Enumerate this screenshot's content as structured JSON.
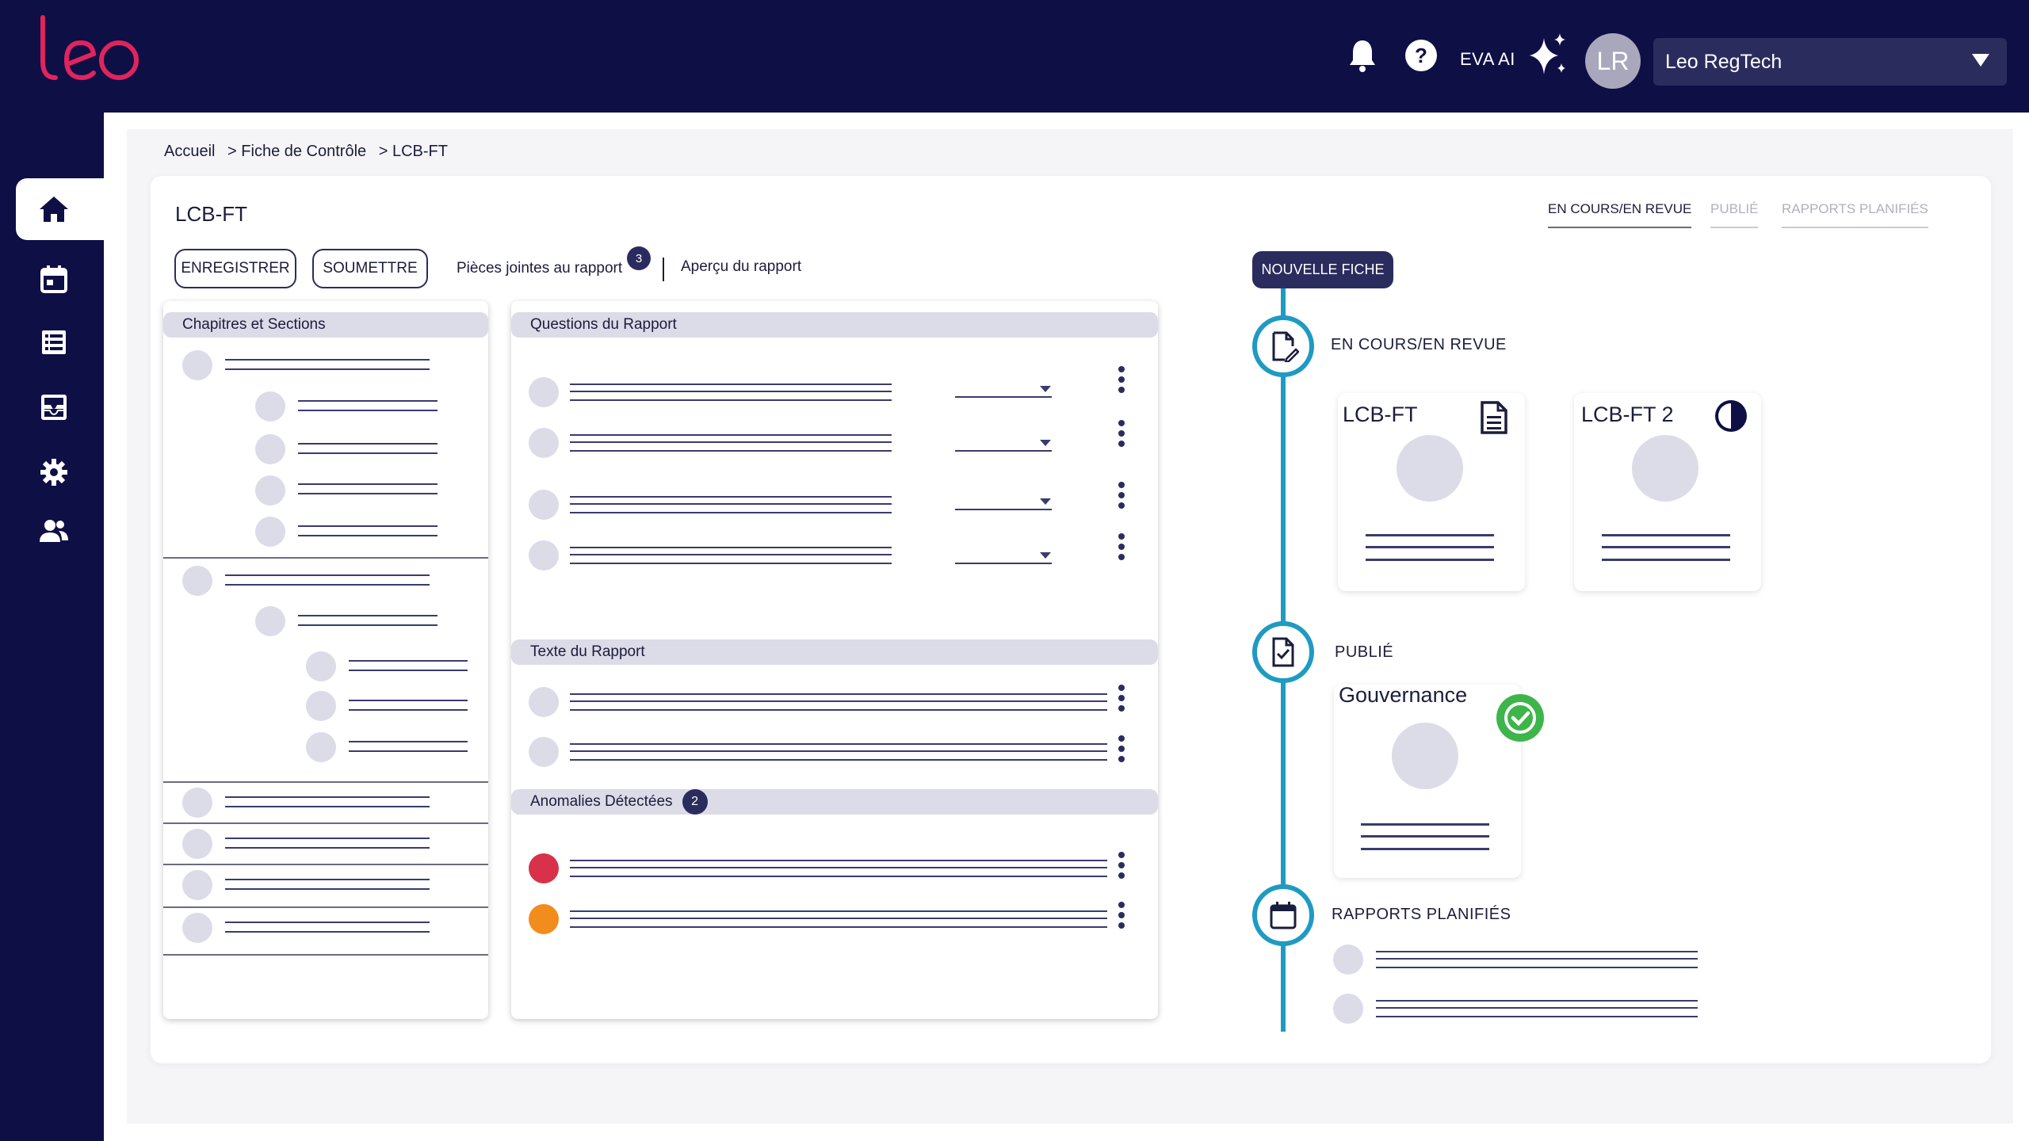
{
  "app": {
    "logo_text": "leo",
    "eva_label": "EVA AI",
    "avatar_initials": "LR",
    "org_selected": "Leo RegTech"
  },
  "colors": {
    "navy": "#0e0f45",
    "accent_pink": "#e0245e",
    "timeline_blue": "#1f9ac2",
    "status_red": "#d7324a",
    "status_orange": "#f28c1c",
    "success_green": "#3db54a"
  },
  "icons": {
    "header": [
      "bell-icon",
      "help-icon",
      "sparkle-icon",
      "chevron-down-icon"
    ],
    "sidebar": [
      "home-icon",
      "calendar-icon",
      "list-icon",
      "inbox-icon",
      "gear-icon",
      "users-icon"
    ]
  },
  "breadcrumb": {
    "home": "Accueil",
    "level1": "> Fiche de Contrôle",
    "level2": "> LCB-FT"
  },
  "page": {
    "title": "LCB-FT"
  },
  "tabs": {
    "in_progress": "EN COURS/EN REVUE",
    "published": "PUBLIÉ",
    "scheduled": "RAPPORTS PLANIFIÉS"
  },
  "toolbar": {
    "save_label": "ENREGISTRER",
    "submit_label": "SOUMETTRE",
    "attachments_label": "Pièces jointes au rapport",
    "attachments_count": "3",
    "preview_label": "Aperçu du rapport"
  },
  "panels": {
    "chapters_title": "Chapitres et Sections",
    "questions_title": "Questions du Rapport",
    "text_title": "Texte du Rapport",
    "anomalies_title": "Anomalies Détectées",
    "anomalies_count": "2"
  },
  "timeline": {
    "new_button": "NOUVELLE FICHE",
    "in_progress_label": "EN COURS/EN REVUE",
    "published_label": "PUBLIÉ",
    "scheduled_label": "RAPPORTS PLANIFIÉS",
    "cards_in_progress": [
      {
        "title": "LCB-FT",
        "icon": "document-icon"
      },
      {
        "title": "LCB-FT 2",
        "icon": "half-circle-progress-icon"
      }
    ],
    "cards_published": [
      {
        "title": "Gouvernance",
        "icon": "check-circle-icon"
      }
    ]
  }
}
